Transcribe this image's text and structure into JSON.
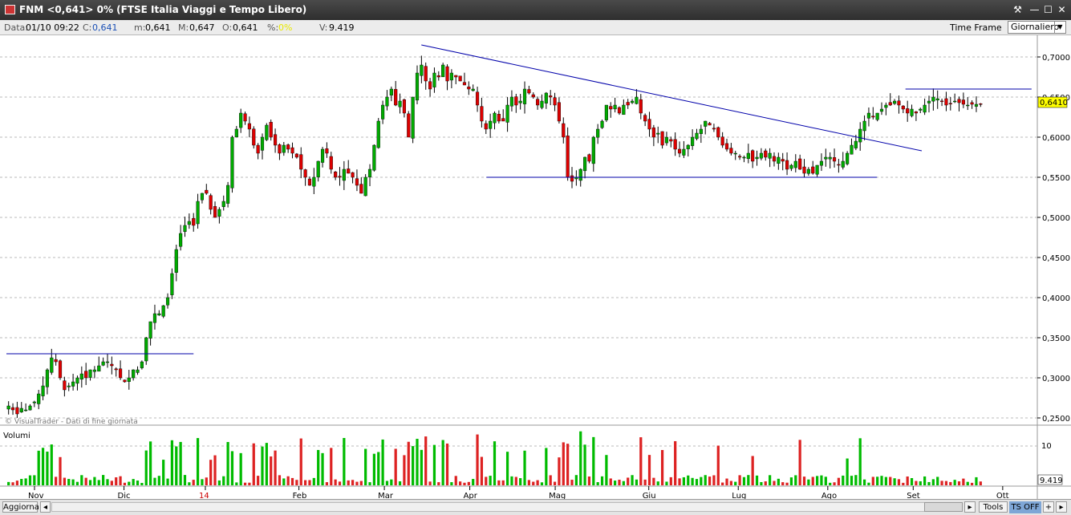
{
  "window": {
    "title": "FNM <0,641> 0%  (FTSE Italia Viaggi e Tempo Libero)",
    "buttons": [
      "⚒",
      "—",
      "☐",
      "✕"
    ]
  },
  "info": {
    "data_label": "Data:",
    "data_value": "01/10 09:22",
    "c_label": "C:",
    "c_value": "0,641",
    "m_label": "m:",
    "m_value": "0,641",
    "M_label": "M:",
    "M_value": "0,647",
    "o_label": "O:",
    "o_value": "0,641",
    "pct_label": "%:",
    "pct_value": "0%",
    "v_label": "V:",
    "v_value": "9.419",
    "timeframe_label": "Time Frame",
    "timeframe_value": "Giornaliero"
  },
  "bottom": {
    "aggiorna": "Aggiorna",
    "tools": "Tools",
    "tsoff": "TS OFF",
    "plus": "+",
    "arrow": "▸",
    "left_arrow": "◂"
  },
  "colors": {
    "up": "#00aa00",
    "down": "#dd0000",
    "trendline": "#0000aa",
    "last_price_bg": "#ffff00",
    "volume_up": "#00bb00",
    "volume_down": "#dd2222"
  },
  "chart_data": {
    "type": "candlestick",
    "title": "FNM <0,641> 0%  (FTSE Italia Viaggi e Tempo Libero)",
    "watermark": "© VisualTrader - Dati di fine giornata",
    "price_axis": {
      "ylim": [
        0.24,
        0.72
      ],
      "ticks": [
        "0,7000",
        "0,6500",
        "0,6000",
        "0,5500",
        "0,5000",
        "0,4500",
        "0,4000",
        "0,3500",
        "0,3000",
        "0,2500"
      ],
      "tick_values": [
        0.7,
        0.65,
        0.6,
        0.55,
        0.5,
        0.45,
        0.4,
        0.35,
        0.3,
        0.25
      ],
      "last_price": "0,6410",
      "last_value": 0.641
    },
    "volume_panel": {
      "label": "Volumi",
      "ticks": [
        "10"
      ],
      "last_value_label": "9.419"
    },
    "x_labels": [
      "Nov",
      "Dic",
      "14",
      "Feb",
      "Mar",
      "Apr",
      "Mag",
      "Giu",
      "Lug",
      "Ago",
      "Set",
      "Ott"
    ],
    "x_label_positions_days": [
      0,
      22,
      42,
      65,
      86,
      107,
      128,
      151,
      173,
      195,
      216,
      238
    ],
    "series_days": 240,
    "closes": [
      0.265,
      0.26,
      0.255,
      0.262,
      0.26,
      0.265,
      0.27,
      0.28,
      0.29,
      0.31,
      0.325,
      0.32,
      0.3,
      0.285,
      0.29,
      0.295,
      0.3,
      0.305,
      0.3,
      0.31,
      0.31,
      0.315,
      0.32,
      0.32,
      0.315,
      0.31,
      0.3,
      0.295,
      0.3,
      0.31,
      0.31,
      0.32,
      0.35,
      0.37,
      0.38,
      0.38,
      0.39,
      0.4,
      0.43,
      0.46,
      0.48,
      0.49,
      0.495,
      0.49,
      0.52,
      0.53,
      0.53,
      0.51,
      0.5,
      0.51,
      0.52,
      0.54,
      0.6,
      0.61,
      0.63,
      0.62,
      0.61,
      0.59,
      0.58,
      0.6,
      0.615,
      0.6,
      0.59,
      0.58,
      0.59,
      0.585,
      0.58,
      0.575,
      0.56,
      0.55,
      0.54,
      0.55,
      0.57,
      0.585,
      0.58,
      0.56,
      0.55,
      0.55,
      0.56,
      0.555,
      0.55,
      0.54,
      0.53,
      0.55,
      0.56,
      0.59,
      0.62,
      0.64,
      0.65,
      0.66,
      0.64,
      0.645,
      0.63,
      0.6,
      0.65,
      0.68,
      0.69,
      0.67,
      0.66,
      0.68,
      0.675,
      0.69,
      0.67,
      0.68,
      0.675,
      0.67,
      0.665,
      0.66,
      0.66,
      0.64,
      0.62,
      0.61,
      0.62,
      0.63,
      0.62,
      0.62,
      0.64,
      0.65,
      0.64,
      0.645,
      0.66,
      0.655,
      0.65,
      0.64,
      0.645,
      0.655,
      0.65,
      0.64,
      0.62,
      0.6,
      0.55,
      0.545,
      0.55,
      0.56,
      0.575,
      0.57,
      0.6,
      0.61,
      0.62,
      0.64,
      0.635,
      0.64,
      0.63,
      0.64,
      0.64,
      0.645,
      0.65,
      0.63,
      0.62,
      0.61,
      0.6,
      0.605,
      0.59,
      0.6,
      0.595,
      0.585,
      0.58,
      0.585,
      0.59,
      0.6,
      0.605,
      0.61,
      0.62,
      0.615,
      0.61,
      0.6,
      0.59,
      0.585,
      0.58,
      0.58,
      0.575,
      0.575,
      0.58,
      0.57,
      0.575,
      0.58,
      0.575,
      0.58,
      0.57,
      0.575,
      0.57,
      0.56,
      0.565,
      0.57,
      0.56,
      0.555,
      0.56,
      0.555,
      0.565,
      0.57,
      0.575,
      0.575,
      0.57,
      0.565,
      0.57,
      0.58,
      0.59,
      0.595,
      0.61,
      0.62,
      0.63,
      0.625,
      0.63,
      0.635,
      0.64,
      0.64,
      0.645,
      0.64,
      0.635,
      0.63,
      0.635,
      0.63,
      0.635,
      0.64,
      0.645,
      0.65,
      0.648,
      0.645,
      0.64,
      0.642,
      0.645,
      0.643,
      0.641,
      0.64,
      0.641,
      0.641,
      0.641
    ],
    "trendlines": [
      {
        "from": {
          "day": 0,
          "price": 0.33
        },
        "to": {
          "day": 46,
          "price": 0.33
        }
      },
      {
        "from": {
          "day": 102,
          "price": 0.715
        },
        "to": {
          "day": 225,
          "price": 0.583
        }
      },
      {
        "from": {
          "day": 118,
          "price": 0.55
        },
        "to": {
          "day": 214,
          "price": 0.55
        }
      },
      {
        "from": {
          "day": 221,
          "price": 0.66
        },
        "to": {
          "day": 252,
          "price": 0.66
        }
      }
    ]
  }
}
